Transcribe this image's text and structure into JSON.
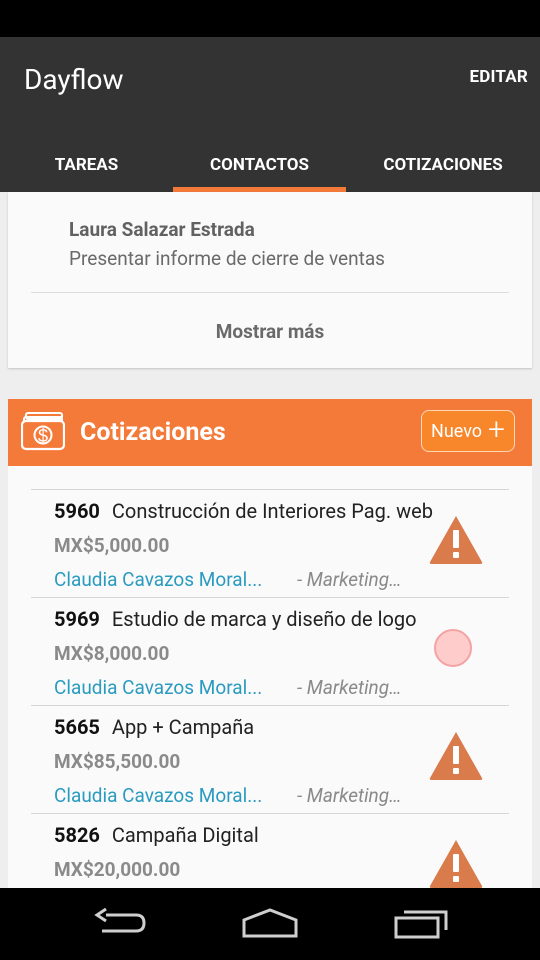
{
  "app": {
    "title": "Dayflow",
    "edit_label": "EDITAR"
  },
  "tabs": [
    {
      "label": "TAREAS",
      "active": false
    },
    {
      "label": "CONTACTOS",
      "active": true
    },
    {
      "label": "COTIZACIONES",
      "active": false
    }
  ],
  "contact_card": {
    "name": "Laura Salazar Estrada",
    "task": "Presentar informe de cierre de ventas",
    "show_more": "Mostrar más"
  },
  "quotes": {
    "title": "Cotizaciones",
    "new_label": "Nuevo",
    "items": [
      {
        "number": "5960",
        "title": "Construcción de Interiores Pag. web",
        "amount": "MX$5,000.00",
        "client": "Claudia Cavazos Moral...",
        "dept": "- Marketing…",
        "status_icon": "warning-icon"
      },
      {
        "number": "5969",
        "title": "Estudio de marca y diseño de logo",
        "amount": "MX$8,000.00",
        "client": "Claudia Cavazos Moral...",
        "dept": "- Marketing…",
        "status_icon": "pending-dot-icon"
      },
      {
        "number": "5665",
        "title": "App + Campaña",
        "amount": "MX$85,500.00",
        "client": "Claudia Cavazos Moral...",
        "dept": "- Marketing…",
        "status_icon": "warning-icon"
      },
      {
        "number": "5826",
        "title": "Campaña Digital",
        "amount": "MX$20,000.00",
        "client": "",
        "dept": "",
        "status_icon": "warning-icon"
      }
    ]
  },
  "colors": {
    "accent": "#f47a3a",
    "app_bar": "#333333",
    "client_link": "#2a9bc0",
    "warning": "#d97b4a"
  },
  "nav_bar": {
    "icons": [
      "back-icon",
      "home-icon",
      "recents-icon"
    ]
  }
}
